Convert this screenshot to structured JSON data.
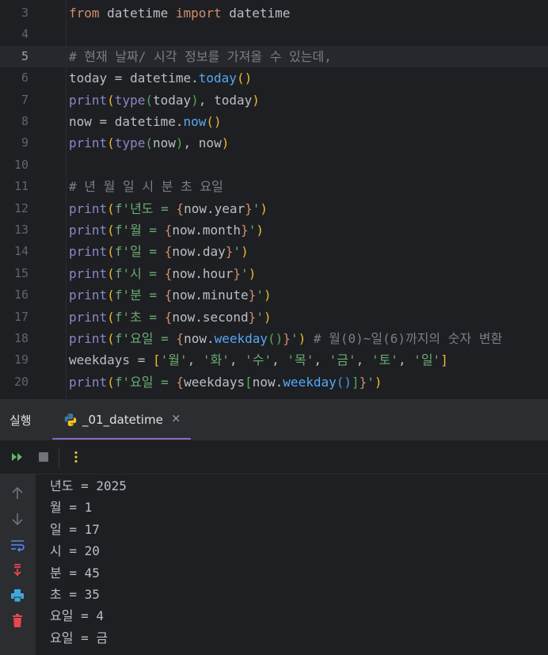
{
  "editor": {
    "lines": [
      {
        "num": "3",
        "tokens": [
          {
            "t": "from",
            "c": "kw"
          },
          {
            "t": " datetime ",
            "c": ""
          },
          {
            "t": "import",
            "c": "kw"
          },
          {
            "t": " datetime",
            "c": ""
          }
        ]
      },
      {
        "num": "4",
        "tokens": []
      },
      {
        "num": "5",
        "current": true,
        "tokens": [
          {
            "t": "# 현재 날짜/ 시각 정보를 가져올 수 있는데,",
            "c": "cm"
          }
        ]
      },
      {
        "num": "6",
        "tokens": [
          {
            "t": "today = datetime.",
            "c": ""
          },
          {
            "t": "today",
            "c": "fn"
          },
          {
            "t": "()",
            "c": "br1"
          }
        ]
      },
      {
        "num": "7",
        "tokens": [
          {
            "t": "print",
            "c": "fnpy"
          },
          {
            "t": "(",
            "c": "br1"
          },
          {
            "t": "type",
            "c": "fnpy"
          },
          {
            "t": "(",
            "c": "br2"
          },
          {
            "t": "today",
            "c": ""
          },
          {
            "t": ")",
            "c": "br2"
          },
          {
            "t": ", today",
            "c": ""
          },
          {
            "t": ")",
            "c": "br1"
          }
        ]
      },
      {
        "num": "8",
        "tokens": [
          {
            "t": "now = datetime.",
            "c": ""
          },
          {
            "t": "now",
            "c": "fn"
          },
          {
            "t": "()",
            "c": "br1"
          }
        ]
      },
      {
        "num": "9",
        "tokens": [
          {
            "t": "print",
            "c": "fnpy"
          },
          {
            "t": "(",
            "c": "br1"
          },
          {
            "t": "type",
            "c": "fnpy"
          },
          {
            "t": "(",
            "c": "br2"
          },
          {
            "t": "now",
            "c": ""
          },
          {
            "t": ")",
            "c": "br2"
          },
          {
            "t": ", now",
            "c": ""
          },
          {
            "t": ")",
            "c": "br1"
          }
        ]
      },
      {
        "num": "10",
        "tokens": []
      },
      {
        "num": "11",
        "tokens": [
          {
            "t": "# 년 월 일 시 분 초 요일",
            "c": "cm"
          }
        ]
      },
      {
        "num": "12",
        "tokens": [
          {
            "t": "print",
            "c": "fnpy"
          },
          {
            "t": "(",
            "c": "br1"
          },
          {
            "t": "f'년도 = ",
            "c": "str"
          },
          {
            "t": "{",
            "c": "brc"
          },
          {
            "t": "now.year",
            "c": ""
          },
          {
            "t": "}",
            "c": "brc"
          },
          {
            "t": "'",
            "c": "str"
          },
          {
            "t": ")",
            "c": "br1"
          }
        ]
      },
      {
        "num": "13",
        "tokens": [
          {
            "t": "print",
            "c": "fnpy"
          },
          {
            "t": "(",
            "c": "br1"
          },
          {
            "t": "f'월 = ",
            "c": "str"
          },
          {
            "t": "{",
            "c": "brc"
          },
          {
            "t": "now.month",
            "c": ""
          },
          {
            "t": "}",
            "c": "brc"
          },
          {
            "t": "'",
            "c": "str"
          },
          {
            "t": ")",
            "c": "br1"
          }
        ]
      },
      {
        "num": "14",
        "tokens": [
          {
            "t": "print",
            "c": "fnpy"
          },
          {
            "t": "(",
            "c": "br1"
          },
          {
            "t": "f'일 = ",
            "c": "str"
          },
          {
            "t": "{",
            "c": "brc"
          },
          {
            "t": "now.day",
            "c": ""
          },
          {
            "t": "}",
            "c": "brc"
          },
          {
            "t": "'",
            "c": "str"
          },
          {
            "t": ")",
            "c": "br1"
          }
        ]
      },
      {
        "num": "15",
        "tokens": [
          {
            "t": "print",
            "c": "fnpy"
          },
          {
            "t": "(",
            "c": "br1"
          },
          {
            "t": "f'시 = ",
            "c": "str"
          },
          {
            "t": "{",
            "c": "brc"
          },
          {
            "t": "now.hour",
            "c": ""
          },
          {
            "t": "}",
            "c": "brc"
          },
          {
            "t": "'",
            "c": "str"
          },
          {
            "t": ")",
            "c": "br1"
          }
        ]
      },
      {
        "num": "16",
        "tokens": [
          {
            "t": "print",
            "c": "fnpy"
          },
          {
            "t": "(",
            "c": "br1"
          },
          {
            "t": "f'분 = ",
            "c": "str"
          },
          {
            "t": "{",
            "c": "brc"
          },
          {
            "t": "now.minute",
            "c": ""
          },
          {
            "t": "}",
            "c": "brc"
          },
          {
            "t": "'",
            "c": "str"
          },
          {
            "t": ")",
            "c": "br1"
          }
        ]
      },
      {
        "num": "17",
        "tokens": [
          {
            "t": "print",
            "c": "fnpy"
          },
          {
            "t": "(",
            "c": "br1"
          },
          {
            "t": "f'초 = ",
            "c": "str"
          },
          {
            "t": "{",
            "c": "brc"
          },
          {
            "t": "now.second",
            "c": ""
          },
          {
            "t": "}",
            "c": "brc"
          },
          {
            "t": "'",
            "c": "str"
          },
          {
            "t": ")",
            "c": "br1"
          }
        ]
      },
      {
        "num": "18",
        "tokens": [
          {
            "t": "print",
            "c": "fnpy"
          },
          {
            "t": "(",
            "c": "br1"
          },
          {
            "t": "f'요일 = ",
            "c": "str"
          },
          {
            "t": "{",
            "c": "brc"
          },
          {
            "t": "now.",
            "c": ""
          },
          {
            "t": "weekday",
            "c": "fn"
          },
          {
            "t": "()",
            "c": "br2"
          },
          {
            "t": "}",
            "c": "brc"
          },
          {
            "t": "'",
            "c": "str"
          },
          {
            "t": ")",
            "c": "br1"
          },
          {
            "t": " # 월(0)~일(6)까지의 숫자 변환",
            "c": "cm"
          }
        ]
      },
      {
        "num": "19",
        "tokens": [
          {
            "t": "weekdays = ",
            "c": ""
          },
          {
            "t": "[",
            "c": "br1"
          },
          {
            "t": "'월'",
            "c": "str"
          },
          {
            "t": ", ",
            "c": ""
          },
          {
            "t": "'화'",
            "c": "str"
          },
          {
            "t": ", ",
            "c": ""
          },
          {
            "t": "'수'",
            "c": "str"
          },
          {
            "t": ", ",
            "c": ""
          },
          {
            "t": "'목'",
            "c": "str"
          },
          {
            "t": ", ",
            "c": ""
          },
          {
            "t": "'금'",
            "c": "str"
          },
          {
            "t": ", ",
            "c": ""
          },
          {
            "t": "'토'",
            "c": "str"
          },
          {
            "t": ", ",
            "c": ""
          },
          {
            "t": "'일'",
            "c": "str"
          },
          {
            "t": "]",
            "c": "br1"
          }
        ]
      },
      {
        "num": "20",
        "tokens": [
          {
            "t": "print",
            "c": "fnpy"
          },
          {
            "t": "(",
            "c": "br1"
          },
          {
            "t": "f'요일 = ",
            "c": "str"
          },
          {
            "t": "{",
            "c": "brc"
          },
          {
            "t": "weekdays",
            "c": ""
          },
          {
            "t": "[",
            "c": "br2"
          },
          {
            "t": "now.",
            "c": ""
          },
          {
            "t": "weekday",
            "c": "fn"
          },
          {
            "t": "()",
            "c": "br3"
          },
          {
            "t": "]",
            "c": "br2"
          },
          {
            "t": "}",
            "c": "brc"
          },
          {
            "t": "'",
            "c": "str"
          },
          {
            "t": ")",
            "c": "br1"
          }
        ]
      }
    ]
  },
  "run_panel": {
    "title": "실행",
    "tab_label": "_01_datetime",
    "tab_close": "×",
    "toolbar_icons": [
      "rerun-icon",
      "stop-icon",
      "more-vertical-icon"
    ],
    "side_icons": [
      "arrow-up-icon",
      "arrow-down-icon",
      "soft-wrap-icon",
      "scroll-to-end-icon",
      "print-icon",
      "trash-icon"
    ],
    "output": [
      "년도 = 2025",
      "월 = 1",
      "일 = 17",
      "시 = 20",
      "분 = 45",
      "초 = 35",
      "요일 = 4",
      "요일 = 금"
    ]
  },
  "colors": {
    "accent": "#8b6ac8",
    "keyword": "#cf8e6d",
    "string": "#6aab73",
    "comment": "#7a7e85",
    "run_icon": "#5fb865",
    "trash_icon": "#e5484d",
    "print_icon": "#3fa9d9"
  }
}
